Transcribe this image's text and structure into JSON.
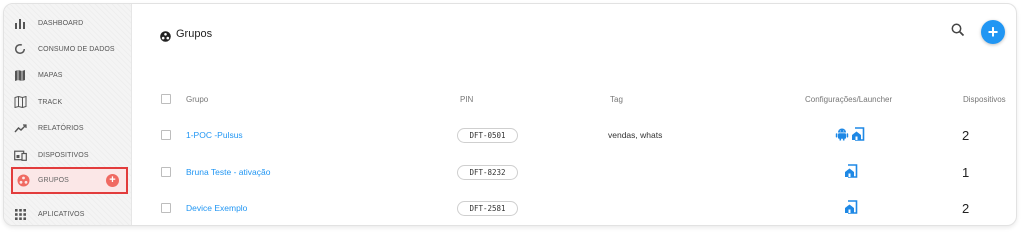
{
  "sidebar": {
    "items": [
      {
        "label": "DASHBOARD",
        "icon": "bar-chart-icon"
      },
      {
        "label": "CONSUMO DE DADOS",
        "icon": "data-usage-icon"
      },
      {
        "label": "MAPAS",
        "icon": "map-icon"
      },
      {
        "label": "TRACK",
        "icon": "track-map-icon"
      },
      {
        "label": "RELATÓRIOS",
        "icon": "trending-line-icon"
      },
      {
        "label": "DISPOSITIVOS",
        "icon": "devices-icon"
      },
      {
        "label": "GRUPOS",
        "icon": "groups-icon",
        "active": true
      },
      {
        "label": "APLICATIVOS",
        "icon": "apps-grid-icon"
      }
    ],
    "add_symbol": "+"
  },
  "main": {
    "title": "Grupos",
    "fab_label": "+",
    "table": {
      "headers": {
        "group": "Grupo",
        "pin": "PIN",
        "tag": "Tag",
        "config": "Configurações/Launcher",
        "devices": "Dispositivos"
      },
      "rows": [
        {
          "name": "1-POC -Pulsus",
          "pin": "DFT-0501",
          "tag": "vendas, whats",
          "config_icons": [
            "android-icon",
            "launcher-icon"
          ],
          "devices": "2"
        },
        {
          "name": "Bruna Teste - ativação",
          "pin": "DFT-8232",
          "tag": "",
          "config_icons": [
            "launcher-icon"
          ],
          "devices": "1"
        },
        {
          "name": "Device Exemplo",
          "pin": "DFT-2581",
          "tag": "",
          "config_icons": [
            "launcher-icon"
          ],
          "devices": "2"
        }
      ]
    }
  },
  "colors": {
    "accent": "#2196f3",
    "active_border": "#e23c3c",
    "active_bg": "#fbe7e7",
    "add_dot": "#f06a62"
  }
}
